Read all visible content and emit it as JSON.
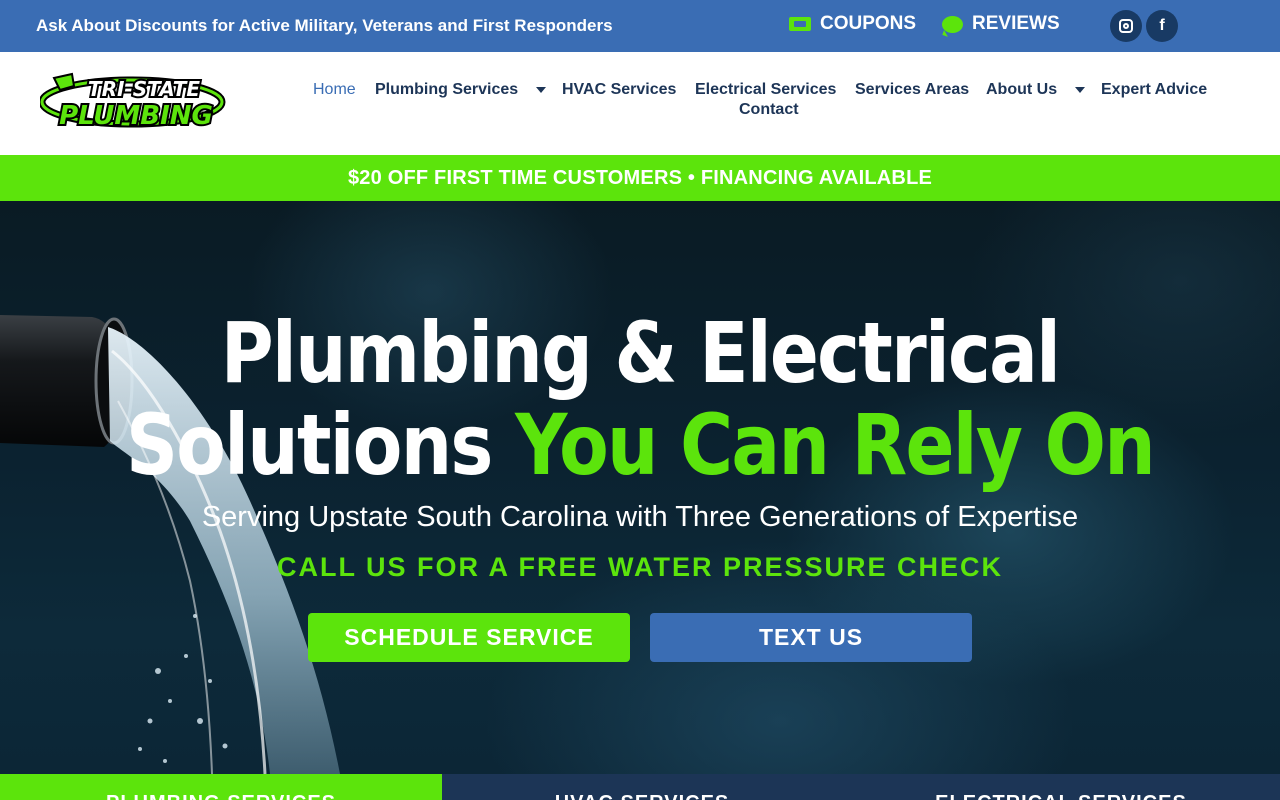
{
  "topbar": {
    "promo": "Ask About Discounts for Active Military, Veterans and First Responders",
    "coupons_label": "COUPONS",
    "coupons_icon": "ticket-icon",
    "reviews_label": "REVIEWS",
    "reviews_icon": "chat-bubble-icon",
    "social": [
      {
        "name": "instagram-icon"
      },
      {
        "name": "facebook-icon",
        "glyph": "f"
      }
    ]
  },
  "logo": {
    "line1": "TRI-STATE",
    "line2": "PLUMBING"
  },
  "nav": {
    "home": "Home",
    "plumbing": "Plumbing Services",
    "hvac": "HVAC Services",
    "electrical": "Electrical Services",
    "areas": "Services Areas",
    "about": "About Us",
    "advice": "Expert Advice",
    "contact": "Contact"
  },
  "banner": "$20 OFF FIRST TIME CUSTOMERS • FINANCING AVAILABLE",
  "hero": {
    "title_line1": "Plumbing & Electrical",
    "title_line2_white": "Solutions ",
    "title_line2_green": "You Can Rely On",
    "subtitle": "Serving Upstate South Carolina with Three Generations of Expertise",
    "cta_text": "CALL US FOR A FREE WATER PRESSURE CHECK",
    "schedule_button": "SCHEDULE SERVICE",
    "text_button": "TEXT US"
  },
  "service_tabs": {
    "plumbing": "PLUMBING SERVICES",
    "hvac": "HVAC SERVICES",
    "electrical": "ELECTRICAL SERVICES"
  },
  "colors": {
    "brand_blue": "#3a6db4",
    "brand_green": "#5ce40c",
    "navy": "#1c3556"
  }
}
